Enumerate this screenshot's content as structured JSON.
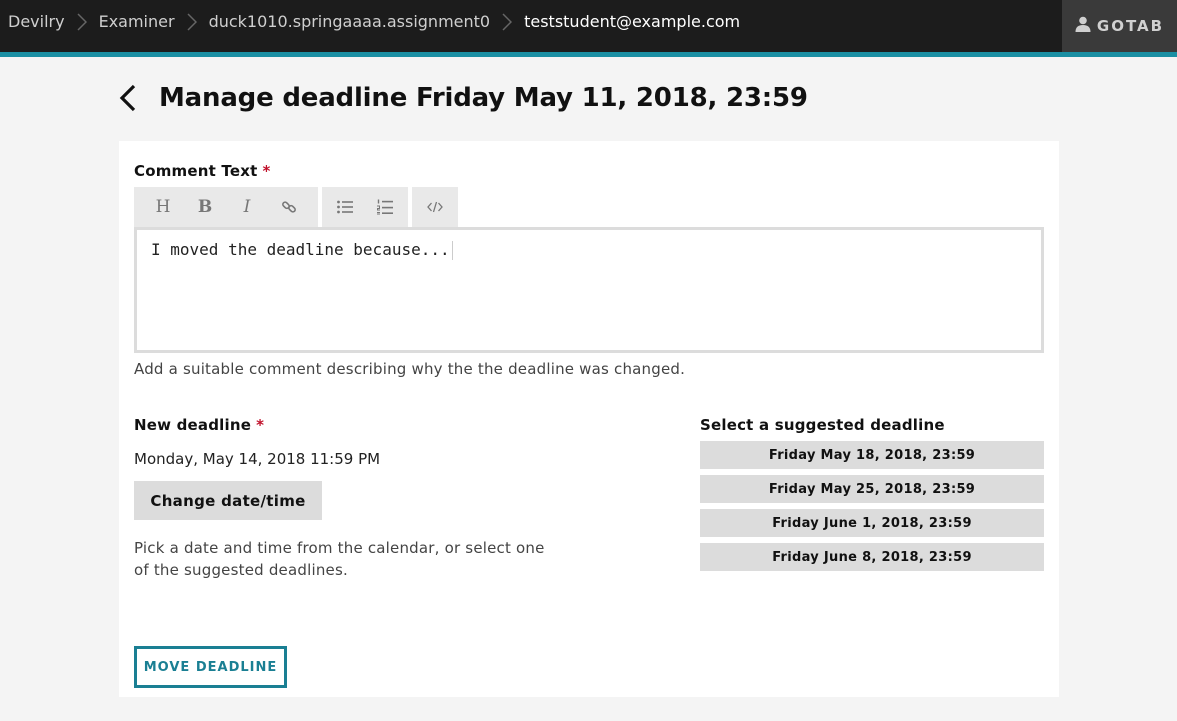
{
  "breadcrumbs": [
    {
      "label": "Devilry"
    },
    {
      "label": "Examiner"
    },
    {
      "label": "duck1010.springaaaa.assignment0"
    },
    {
      "label": "teststudent@example.com"
    }
  ],
  "user": {
    "name": "GOTAB",
    "icon": "user-icon"
  },
  "title": "Manage deadline Friday May 11, 2018, 23:59",
  "comment": {
    "label": "Comment Text",
    "required_mark": "*",
    "toolbar": [
      {
        "name": "heading",
        "glyph": "H"
      },
      {
        "name": "bold",
        "glyph": "B"
      },
      {
        "name": "italic",
        "glyph": "I"
      },
      {
        "name": "link",
        "icon": "link-icon"
      },
      {
        "name": "bullet-list",
        "icon": "bullet-list-icon"
      },
      {
        "name": "numbered-list",
        "icon": "numbered-list-icon"
      },
      {
        "name": "code",
        "icon": "code-icon"
      }
    ],
    "value": "I moved the deadline because...",
    "help": "Add a suitable comment describing why the the deadline was changed."
  },
  "new_deadline": {
    "label": "New deadline",
    "required_mark": "*",
    "value": "Monday, May 14, 2018 11:59 PM",
    "change_button": "Change date/time",
    "help": "Pick a date and time from the calendar, or select one of the suggested deadlines."
  },
  "suggested": {
    "label": "Select a suggested deadline",
    "options": [
      "Friday May 18, 2018, 23:59",
      "Friday May 25, 2018, 23:59",
      "Friday June 1, 2018, 23:59",
      "Friday June 8, 2018, 23:59"
    ]
  },
  "submit_label": "MOVE DEADLINE",
  "colors": {
    "accent": "#1a7f93",
    "topbar": "#1c1c1c",
    "required": "#c0102a"
  }
}
